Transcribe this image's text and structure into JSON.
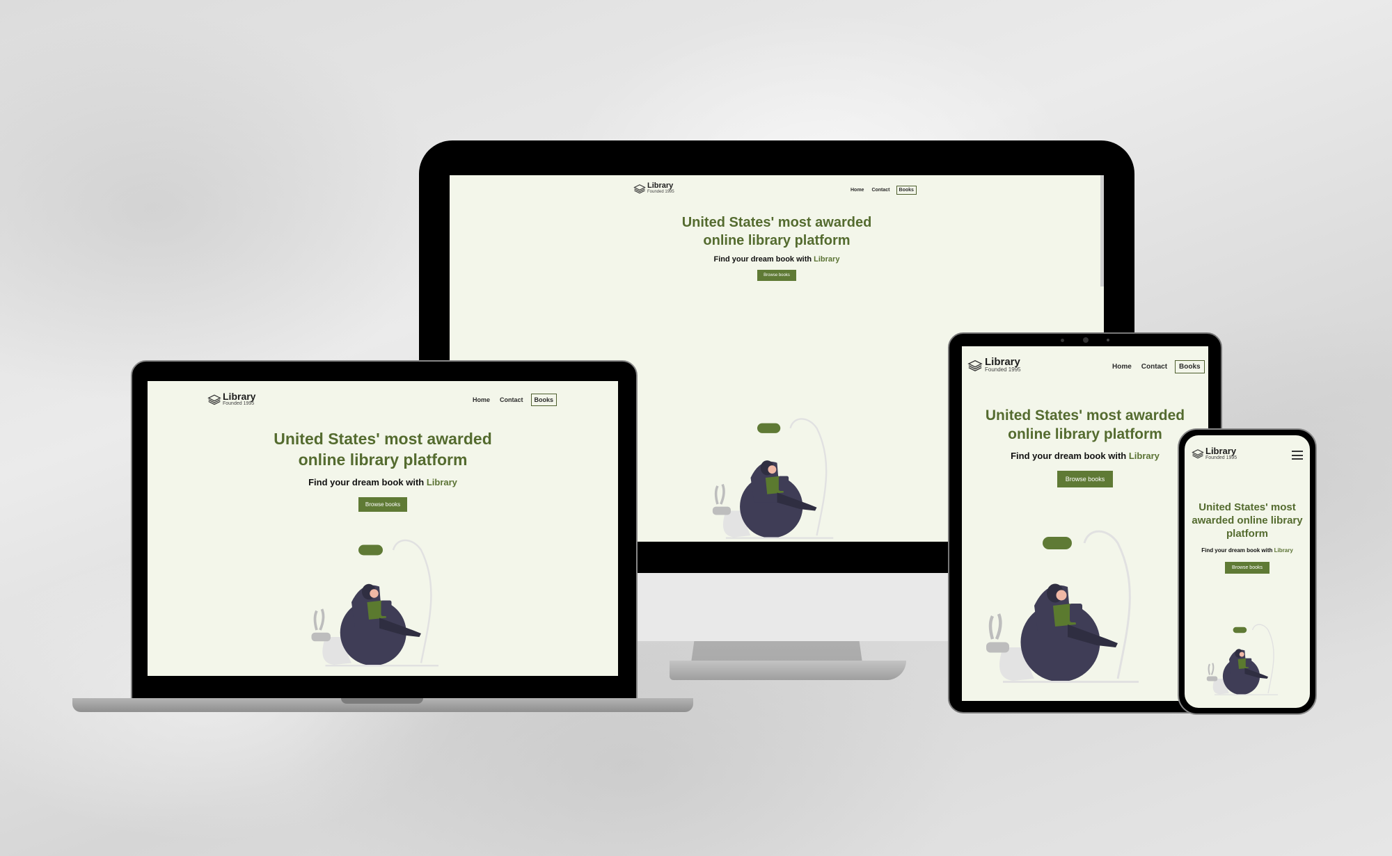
{
  "site": {
    "brand_name": "Library",
    "brand_sub": "Founded 1995",
    "nav": {
      "home": "Home",
      "contact": "Contact",
      "books": "Books"
    },
    "hero_title": "United States' most awarded online library platform",
    "hero_sub_prefix": "Find your dream book with ",
    "hero_sub_accent": "Library",
    "cta": "Browse books"
  },
  "colors": {
    "page_bg": "#f3f6ea",
    "accent": "#546b2f",
    "button": "#5f7a35",
    "chair": "#3f3d56"
  },
  "icons": [
    "books-logo-icon",
    "hamburger-menu-icon"
  ]
}
